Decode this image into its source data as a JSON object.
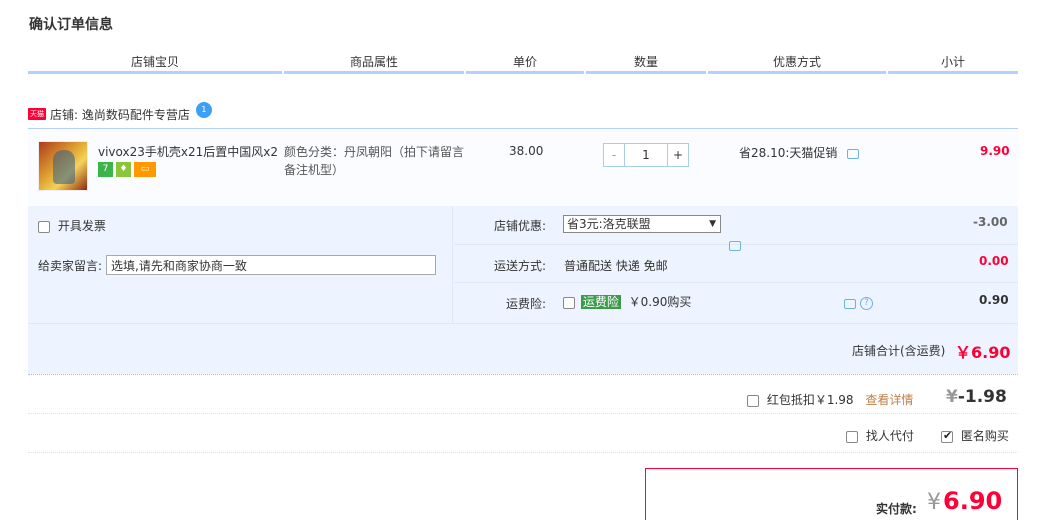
{
  "page": {
    "title": "确认订单信息"
  },
  "header": {
    "columns": [
      "店铺宝贝",
      "商品属性",
      "单价",
      "数量",
      "优惠方式",
      "小计"
    ]
  },
  "shop": {
    "tag": "天猫",
    "label": "店铺: 逸尚数码配件专营店",
    "wangwang_badge": "1"
  },
  "item": {
    "title": "vivox23手机壳x21后置中国风x2...",
    "badges": [
      "7",
      "",
      ""
    ],
    "attr_line1": "颜色分类：丹凤朝阳（拍下请留言",
    "attr_line2": "备注机型）",
    "price": "38.00",
    "qty_minus": "-",
    "qty": "1",
    "qty_plus": "+",
    "discount": "省28.10:天猫促销",
    "subtotal": "9.90"
  },
  "options": {
    "invoice_label": "开具发票",
    "message_label": "给卖家留言:",
    "message_placeholder": "选填,请先和商家协商一致",
    "shop_discount_label": "店铺优惠:",
    "shop_discount_value": "省3元:洛克联盟",
    "shop_discount_amount": "-3.00",
    "shipping_label": "运送方式:",
    "shipping_value": "普通配送 快递 免邮",
    "shipping_amount": "0.00",
    "insurance_label": "运费险:",
    "insurance_tag": "运费险",
    "insurance_value": "￥0.90购买",
    "insurance_amount": "0.90",
    "shop_total_label": "店铺合计(含运费)",
    "shop_total_value": "￥6.90"
  },
  "extras": {
    "redpacket_label": "红包抵扣￥1.98",
    "redpacket_link": "查看详情",
    "redpacket_yen": "¥",
    "redpacket_amount": "-1.98",
    "proxy_label": "找人代付",
    "anon_label": "匿名购买"
  },
  "payment": {
    "label": "实付款:",
    "yen": "¥",
    "amount": "6.90"
  },
  "colors": {
    "accent_red": "#ff0036",
    "header_border": "#b2d1ff",
    "panel_bg": "#eef4ff"
  }
}
